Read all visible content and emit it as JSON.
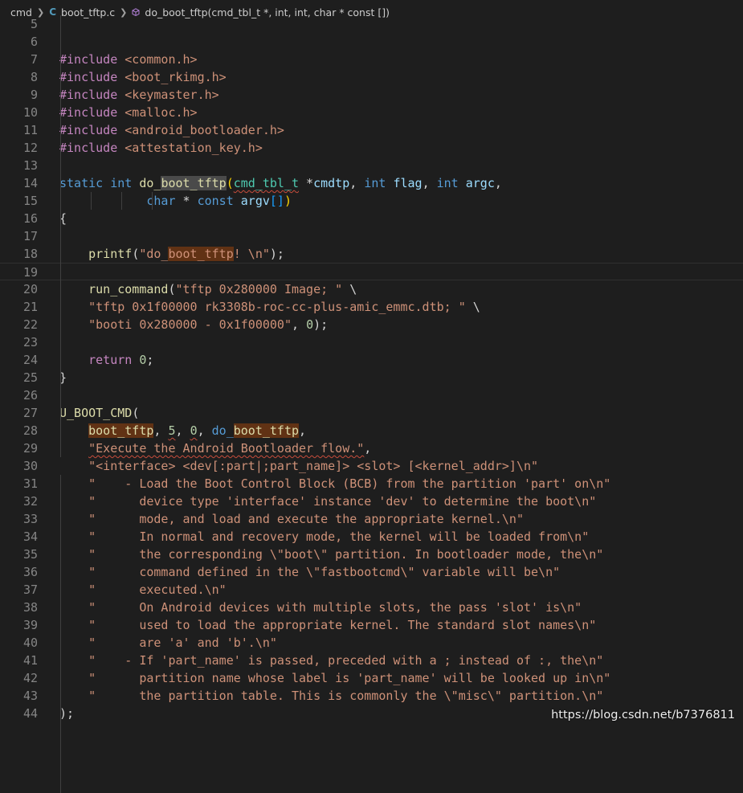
{
  "breadcrumb": {
    "folder": "cmd",
    "file_icon": "C",
    "file": "boot_tftp.c",
    "symbol": "do_boot_tftp(cmd_tbl_t *, int, int, char * const [])"
  },
  "icons": {
    "file": "c-file-icon",
    "symbol": "function-cube-icon",
    "separator": "chevron-right-icon"
  },
  "colors": {
    "background": "#1e1e1e",
    "keyword": "#569cd6",
    "string": "#ce9178",
    "function": "#dcdcaa",
    "preprocessor": "#c586c0"
  },
  "editor": {
    "lines": [
      {
        "n": "5",
        "t": ""
      },
      {
        "n": "6",
        "t": ""
      },
      {
        "n": "7",
        "t": "#include <common.h>"
      },
      {
        "n": "8",
        "t": "#include <boot_rkimg.h>"
      },
      {
        "n": "9",
        "t": "#include <keymaster.h>"
      },
      {
        "n": "10",
        "t": "#include <malloc.h>"
      },
      {
        "n": "11",
        "t": "#include <android_bootloader.h>"
      },
      {
        "n": "12",
        "t": "#include <attestation_key.h>"
      },
      {
        "n": "13",
        "t": ""
      },
      {
        "n": "14",
        "t": "static int do_boot_tftp(cmd_tbl_t *cmdtp, int flag, int argc,"
      },
      {
        "n": "15",
        "t": "\t\t\tchar * const argv[])"
      },
      {
        "n": "16",
        "t": "{"
      },
      {
        "n": "17",
        "t": ""
      },
      {
        "n": "18",
        "t": "\tprintf(\"do_boot_tftp! \\n\");"
      },
      {
        "n": "19",
        "t": ""
      },
      {
        "n": "20",
        "t": "\trun_command(\"tftp 0x280000 Image; \" \\"
      },
      {
        "n": "21",
        "t": "\t\"tftp 0x1f00000 rk3308b-roc-cc-plus-amic_emmc.dtb; \" \\"
      },
      {
        "n": "22",
        "t": "\t\"booti 0x280000 - 0x1f00000\", 0);"
      },
      {
        "n": "23",
        "t": ""
      },
      {
        "n": "24",
        "t": "\treturn 0;"
      },
      {
        "n": "25",
        "t": "}"
      },
      {
        "n": "26",
        "t": ""
      },
      {
        "n": "27",
        "t": "U_BOOT_CMD("
      },
      {
        "n": "28",
        "t": "\tboot_tftp, 5, 0, do_boot_tftp,"
      },
      {
        "n": "29",
        "t": "\t\"Execute the Android Bootloader flow.\","
      },
      {
        "n": "30",
        "t": "\t\"<interface> <dev[:part|;part_name]> <slot> [<kernel_addr>]\\n\""
      },
      {
        "n": "31",
        "t": "\t\"    - Load the Boot Control Block (BCB) from the partition 'part' on\\n\""
      },
      {
        "n": "32",
        "t": "\t\"      device type 'interface' instance 'dev' to determine the boot\\n\""
      },
      {
        "n": "33",
        "t": "\t\"      mode, and load and execute the appropriate kernel.\\n\""
      },
      {
        "n": "34",
        "t": "\t\"      In normal and recovery mode, the kernel will be loaded from\\n\""
      },
      {
        "n": "35",
        "t": "\t\"      the corresponding \\\"boot\\\" partition. In bootloader mode, the\\n\""
      },
      {
        "n": "36",
        "t": "\t\"      command defined in the \\\"fastbootcmd\\\" variable will be\\n\""
      },
      {
        "n": "37",
        "t": "\t\"      executed.\\n\""
      },
      {
        "n": "38",
        "t": "\t\"      On Android devices with multiple slots, the pass 'slot' is\\n\""
      },
      {
        "n": "39",
        "t": "\t\"      used to load the appropriate kernel. The standard slot names\\n\""
      },
      {
        "n": "40",
        "t": "\t\"      are 'a' and 'b'.\\n\""
      },
      {
        "n": "41",
        "t": "\t\"    - If 'part_name' is passed, preceded with a ; instead of :, the\\n\""
      },
      {
        "n": "42",
        "t": "\t\"      partition name whose label is 'part_name' will be looked up in\\n\""
      },
      {
        "n": "43",
        "t": "\t\"      the partition table. This is commonly the \\\"misc\\\" partition.\\n\""
      },
      {
        "n": "44",
        "t": ");"
      }
    ]
  },
  "watermark": "https://blog.csdn.net/b7376811"
}
